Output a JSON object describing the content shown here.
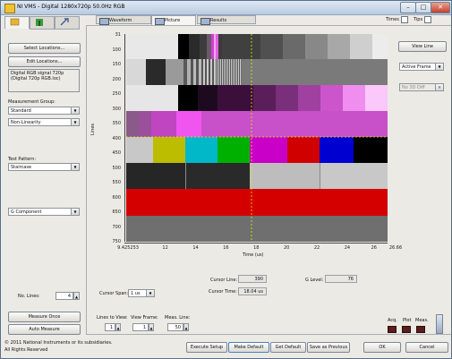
{
  "window": {
    "title": "NI VMS - Digital 1280x720p 50.0Hz RGB"
  },
  "left_panel": {
    "select_locations": "Select Locations...",
    "edit_locations": "Edit Locations...",
    "signal_desc": "Digital RGB signal 720p (Digital 720p RGB.loc)",
    "measurement_group_label": "Measurement Group:",
    "measurement_group_value": "Standard",
    "measurement_value": "Non-Linearity",
    "test_pattern_label": "Test Pattern:",
    "test_pattern_value": "Staircase",
    "component_value": "G Component",
    "no_lines_label": "No. Lines:",
    "no_lines_value": "4",
    "measure_once": "Measure Once",
    "auto_measure": "Auto Measure"
  },
  "tabs": [
    {
      "label": "Waveform"
    },
    {
      "label": "Picture"
    },
    {
      "label": "Results"
    }
  ],
  "top_right": {
    "times_label": "Times",
    "tips_label": "Tips"
  },
  "plot": {
    "y_label": "Lines",
    "x_label": "Time (us)",
    "y_ticks": [
      "31",
      "100",
      "150",
      "200",
      "250",
      "300",
      "350",
      "400",
      "450",
      "500",
      "550",
      "600",
      "650",
      "700",
      "750"
    ],
    "x_ticks": [
      "9.425253",
      "12",
      "14",
      "16",
      "18",
      "20",
      "22",
      "24",
      "26",
      "26.66"
    ],
    "cursor_color": "#e8e800"
  },
  "right_panel": {
    "view_line": "View Line",
    "active_frame": "Active Frame",
    "no_3d_diff": "No 3D Diff"
  },
  "cursor": {
    "span_label": "Cursor Span:",
    "span_value": "1 us",
    "line_label": "Cursor Line:",
    "line_value": "390",
    "time_label": "Cursor Time:",
    "time_value": "18.04 us",
    "glevel_label": "G Level:",
    "glevel_value": "76"
  },
  "view_controls": {
    "lines_to_view_label": "Lines to View:",
    "lines_to_view_value": "1",
    "view_frame_label": "View Frame:",
    "view_frame_value": "1",
    "meas_line_label": "Meas. Line:",
    "meas_line_value": "50"
  },
  "indicators": {
    "acq": "Acq.",
    "plot": "Plot",
    "meas": "Meas."
  },
  "footer": {
    "copyright1": "© 2011 National Instruments or its subsidiaries.",
    "copyright2": "All Rights Reserved",
    "execute_setup": "Execute Setup",
    "make_default": "Make Default",
    "get_default": "Get Default",
    "save_as_previous": "Save as Previous",
    "ok": "OK",
    "cancel": "Cancel"
  }
}
